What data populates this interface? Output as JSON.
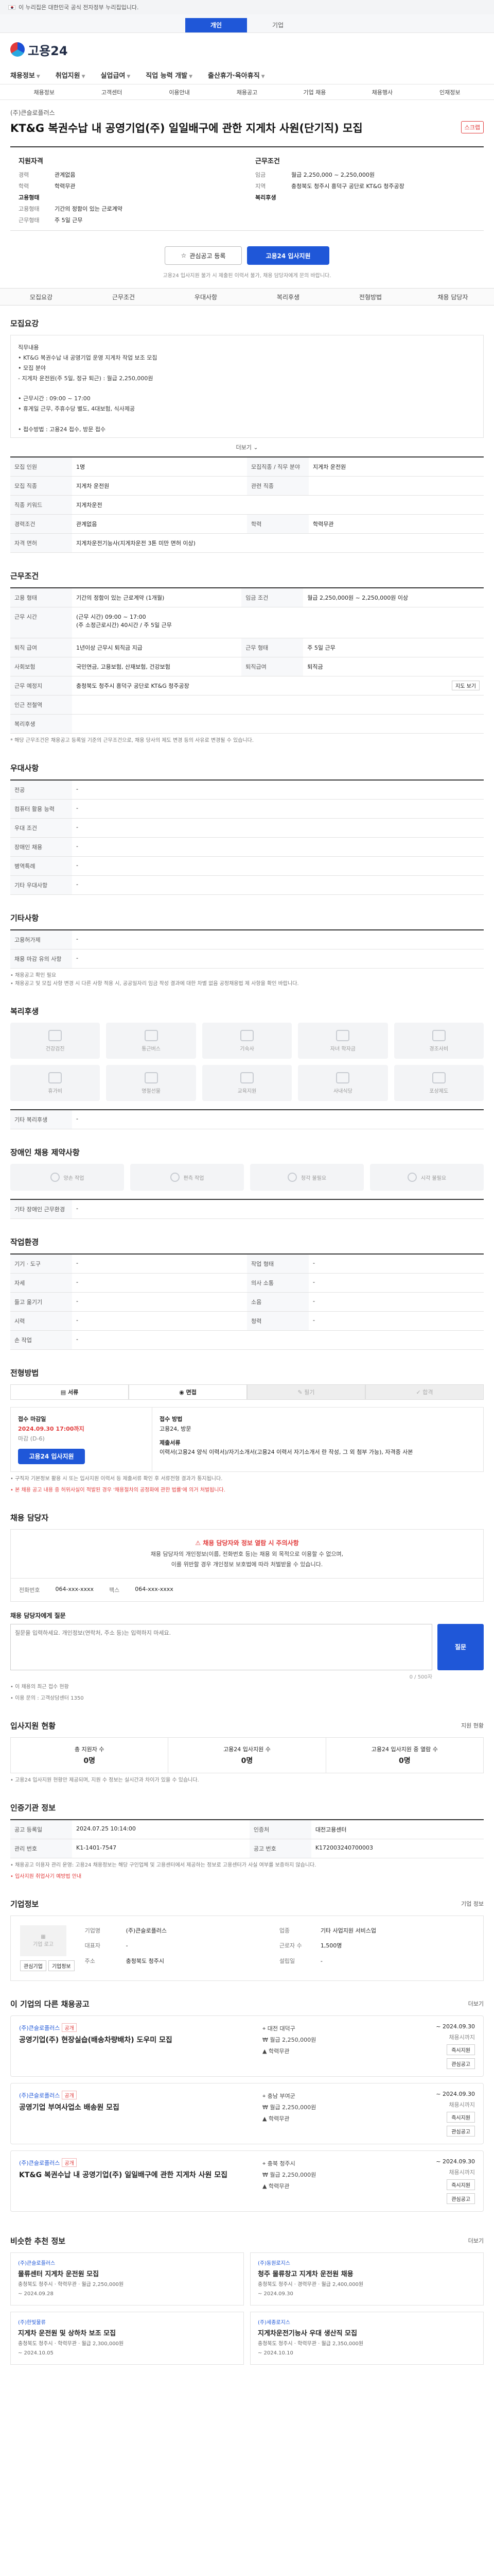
{
  "govbar": {
    "text": "이 누리집은 대한민국 공식 전자정부 누리집입니다."
  },
  "top_tabs": [
    "개인",
    "기업"
  ],
  "logo": {
    "name": "고용24"
  },
  "gnb": [
    "채용정보",
    "취업지원",
    "실업급여",
    "직업 능력 개발",
    "출산휴가·육아휴직"
  ],
  "subnav": [
    "채용정보",
    "고객센터",
    "이용안내",
    "채용공고",
    "기업 채용",
    "채용행사",
    "인재정보"
  ],
  "job": {
    "company": "(주)큰슬로플러스",
    "badge": "",
    "title": "KT&G 복권수납 내 공영기업(주) 일일배구에 관한 지게차 사원(단기직) 모집",
    "scrap": "스크랩"
  },
  "summary": {
    "left_title": "지원자격",
    "left": [
      {
        "k": "경력",
        "v": "관계없음"
      },
      {
        "k": "학력",
        "v": "학력무관"
      },
      {
        "k": "",
        "v": ""
      },
      {
        "k": "고용형태",
        "v": ""
      },
      {
        "k": "고용형태",
        "v": "기간의 정함이 있는 근로계약"
      },
      {
        "k": "근무형태",
        "v": "주 5일 근무"
      }
    ],
    "right_title": "근무조건",
    "right": [
      {
        "k": "임금",
        "v": "월급 2,250,000 ~ 2,250,000원"
      },
      {
        "k": "지역",
        "v": "충청북도 청주시 흥덕구 공단로 KT&G 청주공장"
      },
      {
        "k": "",
        "v": ""
      },
      {
        "k": "복리후생",
        "v": ""
      }
    ]
  },
  "apply": {
    "btn_interest": "관심공고 등록",
    "btn_apply": "고용24 입사지원",
    "note": "고용24 입사지원 불가 시 제출된 이력서 불가, 채용 담당자에게 문의 바랍니다."
  },
  "anchor_nav": [
    "모집요강",
    "근무조건",
    "우대사항",
    "복리후생",
    "전형방법",
    "채용 담당자"
  ],
  "recruit": {
    "title": "모집요강",
    "desc": "직무내용\n• KT&G 복권수납 내 공영기업 운영 지게차 작업 보조 모집\n• 모집 분야\n  - 지게차 운전원(주 5일, 정규 퇴근) : 월급 2,250,000원\n\n• 근무시간 : 09:00 ~ 17:00\n• 휴게일 근무, 주휴수당 별도, 4대보험, 식사제공\n\n• 접수방법 : 고용24 접수, 방문 접수",
    "expand": "더보기",
    "rows": [
      {
        "k": "모집 인원",
        "v": "1명",
        "k2": "모집직종 / 직무 분야",
        "v2": "지게차 운전원"
      },
      {
        "k": "모집 직종",
        "v": "지게차 운전원",
        "k2": "관련 직종",
        "v2": ""
      },
      {
        "k": "직종 키워드",
        "v": "지게차운전",
        "k2": "",
        "v2": ""
      },
      {
        "k": "경력조건",
        "v": "관계없음",
        "k2": "학력",
        "v2": "학력무관"
      },
      {
        "k": "자격 면허",
        "v": "지게차운전기능사(지게차운전 3톤 미만 면허 이상)",
        "k2": "",
        "v2": ""
      }
    ]
  },
  "conditions": {
    "title": "근무조건",
    "rows": [
      {
        "k": "고용 형태",
        "v": "기간의 정함이 있는 근로계약 (1개월)",
        "k2": "임금 조건",
        "v2": "월급 2,250,000원 ~ 2,250,000원 이상"
      },
      {
        "k": "근무 시간",
        "v": "(근무 시간) 09:00 ~ 17:00\n(주 소정근로시간) 40시간 / 주 5일 근무",
        "k2": "",
        "v2": ""
      },
      {
        "k": "퇴직 급여",
        "v": "1년이상 근무시 퇴직금 지급",
        "k2": "근무 형태",
        "v2": "주 5일 근무"
      },
      {
        "k": "사회보험",
        "v": "국민연금, 고용보험, 산재보험, 건강보험",
        "k2": "퇴직급여",
        "v2": "퇴직금"
      },
      {
        "k": "근무 예정지",
        "v": "충청북도 청주시 흥덕구 공단로 KT&G 청주공장",
        "k2": "",
        "v2": ""
      },
      {
        "k": "인근 전철역",
        "v": "",
        "k2": "",
        "v2": ""
      },
      {
        "k": "복리후생",
        "v": "",
        "k2": "",
        "v2": ""
      }
    ],
    "map_btn": "지도 보기",
    "note": "* 해당 근무조건은 채용공고 등록일 기준의 근무조건으로, 채용 당사의 제도 변경 등의 사유로 변경될 수 있습니다."
  },
  "preferred": {
    "title": "우대사항",
    "rows": [
      {
        "k": "전공",
        "v": "-"
      },
      {
        "k": "컴퓨터 활용 능력",
        "v": "-"
      },
      {
        "k": "우대 조건",
        "v": "-"
      },
      {
        "k": "장애인 채용",
        "v": "-"
      },
      {
        "k": "병역특례",
        "v": "-"
      },
      {
        "k": "기타 우대사항",
        "v": "-"
      }
    ]
  },
  "etc": {
    "title": "기타사항",
    "rows": [
      {
        "k": "고용허가제",
        "v": "-"
      },
      {
        "k": "채용 마감 유의 사항",
        "v": "-"
      }
    ],
    "notes": "• 채용공고 확인 필요\n• 채용공고 및 모집 사항 변경 시 다른 사항 적용 시, 공공일자리 임금 작성 결과에 대한 차별 없음 공정채용법 제 사항을 확인 바랍니다."
  },
  "welfare": {
    "title": "복리후생",
    "items": [
      "건강검진",
      "통근버스",
      "기숙사",
      "자녀 학자금",
      "경조사비",
      "휴가비",
      "명절선물",
      "교육지원",
      "사내식당",
      "포상제도"
    ],
    "other_label": "기타 복리후생",
    "other": "-"
  },
  "disabled_env": {
    "title": "장애인 채용 제약사항",
    "items": [
      "양손 작업",
      "편측 작업",
      "청각 불필요",
      "시각 불필요"
    ],
    "other_label": "기타 장애인 근무환경",
    "other": "-"
  },
  "workplace": {
    "title": "작업환경",
    "rows": [
      {
        "k": "기기 · 도구",
        "v": "-",
        "k2": "작업 형태",
        "v2": "-"
      },
      {
        "k": "자세",
        "v": "-",
        "k2": "의사 소통",
        "v2": "-"
      },
      {
        "k": "들고 옮기기",
        "v": "-",
        "k2": "소음",
        "v2": "-"
      },
      {
        "k": "시력",
        "v": "-",
        "k2": "청력",
        "v2": "-"
      },
      {
        "k": "손 작업",
        "v": "-",
        "k2": "",
        "v2": ""
      }
    ]
  },
  "process": {
    "title": "전형방법",
    "tabs": [
      "서류",
      "면접",
      "필기",
      "합격"
    ],
    "deadline_label": "접수 마감일",
    "deadline": "2024.09.30 17:00까지",
    "deadline_sub": "마감 (D-6)",
    "method_label": "접수 방법",
    "method": "고용24, 방문",
    "docs_label": "제출서류",
    "docs": "이력서(고용24 양식 이력서)/자기소개서(고용24 이력서 자기소개서 란 작성, 그 외 첨부 가능), 자격증 사본",
    "note1": "• 구직자 기본정보 활용 시 또는 입사지원 이력서 등 제출서류 확인 후 서류전형 결과가 통지됩니다.",
    "note2": "• 본 채용 공고 내용 중 허위사실이 적발된 경우 '채용절차의 공정화에 관한 법률'에 의거 처벌됩니다."
  },
  "contact": {
    "title": "채용 담당자",
    "warn_title": "채용 담당자와 정보 열람 시 주의사항",
    "warn_body": "채용 담당자의 개인정보(이름, 전화번호 등)는 채용 외 목적으로 이용할 수 없으며,\n이를 위반할 경우 개인정보 보호법에 따라 처벌받을 수 있습니다.",
    "phone_label": "전화번호",
    "phone": "064-xxx-xxxx",
    "fax_label": "팩스",
    "fax": "064-xxx-xxxx",
    "q_label": "채용 담당자에게 질문",
    "q_placeholder": "질문을 입력하세요. 개인정보(연락처, 주소 등)는 입력하지 마세요.",
    "q_btn": "질문",
    "counter": "0 / 500자",
    "note": "• 이 채용의 최근 접수 현황",
    "note2": "• 이용 문의 : 고객상담센터 1350"
  },
  "applicants": {
    "title": "입사지원 현황",
    "more": "지원 현황",
    "stats": [
      {
        "label": "총 지원자 수",
        "value": "0명"
      },
      {
        "label": "고용24 입사지원 수",
        "value": "0명"
      },
      {
        "label": "고용24 입사지원 중 열람 수",
        "value": "0명"
      }
    ],
    "note": "• 고용24 입사지원 현황만 제공되며, 지원 수 정보는 실시간과 차이가 있을 수 있습니다."
  },
  "notice_info": {
    "title": "인증기관 정보",
    "rows": [
      {
        "k": "공고 등록일",
        "v": "2024.07.25 10:14:00",
        "k2": "인증처",
        "v2": "대전고용센터"
      },
      {
        "k": "관리 번호",
        "v": "K1-1401-7547",
        "k2": "공고 번호",
        "v2": "K172003240700003"
      }
    ],
    "note1": "• 채용공고 이용자 관리 운영: 고용24 채용정보는 해당 구인업체 및 고용센터에서 제공하는 정보로 고용센터가 사실 여부를 보증하지 않습니다.",
    "note2": "• 입사지원 취업사기 예방법 안내"
  },
  "company": {
    "title": "기업정보",
    "more": "기업 정보",
    "logo_text": "기업 로고",
    "btns": [
      "관심기업",
      "기업정보"
    ],
    "rows": [
      {
        "k": "기업명",
        "v": "(주)큰슬로플러스",
        "k2": "업종",
        "v2": "기타 사업지원 서비스업"
      },
      {
        "k": "대표자",
        "v": "-",
        "k2": "근로자 수",
        "v2": "1,500명"
      },
      {
        "k": "주소",
        "v": "충청북도 청주시",
        "k2": "설립일",
        "v2": "-"
      }
    ]
  },
  "same_company": {
    "title": "이 기업의 다른 채용공고",
    "more": "더보기",
    "cards": [
      {
        "cname": "(주)큰슬로플러스",
        "tag": "공개",
        "title": "공영기업(주) 현장실습(배송차량배차) 도우미 모집",
        "loc": "대전 대덕구",
        "pay": "월급 2,250,000원",
        "edu": "학력무관",
        "period": "~ 2024.09.30",
        "status": "채용시까지",
        "btns": [
          "즉시지원",
          "관심공고"
        ]
      },
      {
        "cname": "(주)큰슬로플러스",
        "tag": "공개",
        "title": "공영기업 부여사업소 배송원 모집",
        "loc": "충남 부여군",
        "pay": "월급 2,250,000원",
        "edu": "학력무관",
        "period": "~ 2024.09.30",
        "status": "채용시까지",
        "btns": [
          "즉시지원",
          "관심공고"
        ]
      },
      {
        "cname": "(주)큰슬로플러스",
        "tag": "공개",
        "title": "KT&G 복권수납 내 공영기업(주) 일일배구에 관한 지게차 사원 모집",
        "loc": "충북 청주시",
        "pay": "월급 2,250,000원",
        "edu": "학력무관",
        "period": "~ 2024.09.30",
        "status": "채용시까지",
        "btns": [
          "즉시지원",
          "관심공고"
        ]
      }
    ]
  },
  "recommend": {
    "title": "비슷한 추천 정보",
    "more": "더보기",
    "cards": [
      {
        "cn": "(주)큰슬로플러스",
        "title": "물류센터 지게차 운전원 모집",
        "meta": "충청북도 청주시 · 학력무관 · 월급 2,250,000원",
        "date": "~ 2024.09.28"
      },
      {
        "cn": "(주)동원로지스",
        "title": "청주 물류창고 지게차 운전원 채용",
        "meta": "충청북도 청주시 · 경력무관 · 월급 2,400,000원",
        "date": "~ 2024.09.30"
      },
      {
        "cn": "(주)한빛물류",
        "title": "지게차 운전원 및 상하차 보조 모집",
        "meta": "충청북도 청주시 · 학력무관 · 월급 2,300,000원",
        "date": "~ 2024.10.05"
      },
      {
        "cn": "(주)세종로지스",
        "title": "지게차운전기능사 우대 생산직 모집",
        "meta": "충청북도 청주시 · 학력무관 · 월급 2,350,000원",
        "date": "~ 2024.10.10"
      }
    ]
  }
}
